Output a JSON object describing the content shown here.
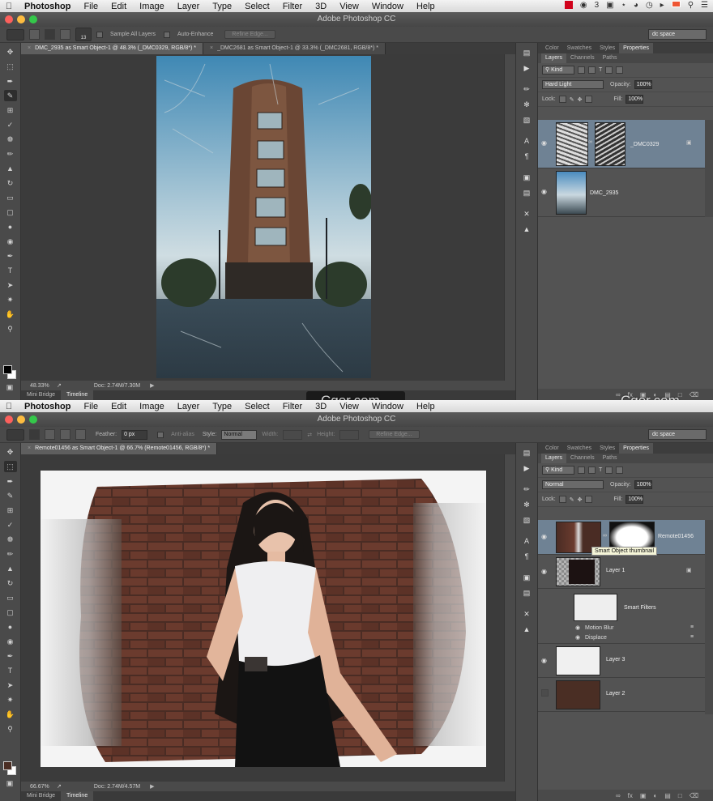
{
  "menubar": {
    "app": "Photoshop",
    "items": [
      "File",
      "Edit",
      "Image",
      "Layer",
      "Type",
      "Select",
      "Filter",
      "3D",
      "View",
      "Window",
      "Help"
    ],
    "tray_count": "3"
  },
  "window1": {
    "title": "Adobe Photoshop CC",
    "options": {
      "brush_size": "13",
      "sample_all_layers": "Sample All Layers",
      "auto_enhance": "Auto-Enhance",
      "refine_edge": "Refine Edge...",
      "workspace": "dc space"
    },
    "tabs": [
      {
        "label": "DMC_2935 as Smart Object-1 @ 48.3% (_DMC0329, RGB/8*) *",
        "active": true
      },
      {
        "label": "_DMC2681 as Smart Object-1 @ 33.3% (_DMC2681, RGB/8*) *",
        "active": false
      }
    ],
    "status": {
      "zoom": "48.33%",
      "doc": "Doc: 2.74M/7.30M"
    },
    "bottom_tabs": [
      "Mini Bridge",
      "Timeline"
    ],
    "panel": {
      "top_tabs": [
        "Color",
        "Swatches",
        "Styles",
        "Properties"
      ],
      "sub_tabs": [
        "Layers",
        "Channels",
        "Paths"
      ],
      "filter": "Kind",
      "blend_mode": "Hard Light",
      "opacity_label": "Opacity:",
      "opacity": "100%",
      "lock_label": "Lock:",
      "fill_label": "Fill:",
      "fill": "100%",
      "layers": [
        {
          "name": "_DMC0329",
          "selected": true
        },
        {
          "name": "DMC_2935",
          "selected": false
        }
      ]
    }
  },
  "window2": {
    "title": "Adobe Photoshop CC",
    "options": {
      "feather_label": "Feather:",
      "feather": "0 px",
      "anti_alias": "Anti-alias",
      "style_label": "Style:",
      "style": "Normal",
      "width_label": "Width:",
      "height_label": "Height:",
      "refine_edge": "Refine Edge...",
      "workspace": "dc space"
    },
    "tabs": [
      {
        "label": "Remote01456 as Smart Object-1 @ 66.7% (Remote01456, RGB/8*) *",
        "active": true
      }
    ],
    "status": {
      "zoom": "66.67%",
      "doc": "Doc: 2.74M/4.57M"
    },
    "bottom_tabs": [
      "Mini Bridge",
      "Timeline"
    ],
    "panel": {
      "top_tabs": [
        "Color",
        "Swatches",
        "Styles",
        "Properties"
      ],
      "sub_tabs": [
        "Layers",
        "Channels",
        "Paths"
      ],
      "filter": "Kind",
      "blend_mode": "Normal",
      "opacity_label": "Opacity:",
      "opacity": "100%",
      "lock_label": "Lock:",
      "fill_label": "Fill:",
      "fill": "100%",
      "tooltip": "Smart Object thumbnail",
      "layers": [
        {
          "name": "Remote01456",
          "selected": true
        },
        {
          "name": "Layer 1",
          "selected": false
        },
        {
          "name": "Smart Filters",
          "selected": false
        },
        {
          "name": "Layer 3",
          "selected": false
        },
        {
          "name": "Layer 2",
          "selected": false
        }
      ],
      "smart_filters": [
        "Motion Blur",
        "Displace"
      ]
    }
  },
  "watermarks": [
    "Cger.com",
    "Cger.com"
  ],
  "colors": {
    "panel_bg": "#535353",
    "selected_layer": "#6f8294",
    "menubar": "#e6e6e6"
  }
}
